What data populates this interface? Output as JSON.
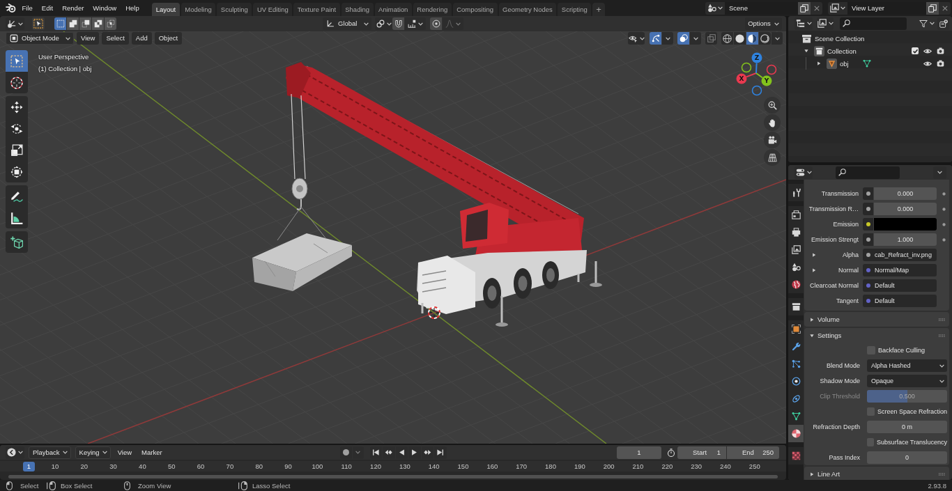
{
  "topbar": {
    "menus": [
      "File",
      "Edit",
      "Render",
      "Window",
      "Help"
    ],
    "workspaces": [
      {
        "label": "Layout",
        "selected": true
      },
      {
        "label": "Modeling",
        "selected": false
      },
      {
        "label": "Sculpting",
        "selected": false
      },
      {
        "label": "UV Editing",
        "selected": false
      },
      {
        "label": "Texture Paint",
        "selected": false
      },
      {
        "label": "Shading",
        "selected": false
      },
      {
        "label": "Animation",
        "selected": false
      },
      {
        "label": "Rendering",
        "selected": false
      },
      {
        "label": "Compositing",
        "selected": false
      },
      {
        "label": "Geometry Nodes",
        "selected": false
      },
      {
        "label": "Scripting",
        "selected": false
      }
    ],
    "add_workspace": "+",
    "scene": "Scene",
    "view_layer": "View Layer"
  },
  "viewport": {
    "tool_settings": {
      "select_modes": [
        {
          "kind": "set",
          "selected": true
        },
        {
          "kind": "extend",
          "selected": false
        },
        {
          "kind": "subtract",
          "selected": false
        },
        {
          "kind": "difference",
          "selected": false
        },
        {
          "kind": "intersect",
          "selected": false
        }
      ],
      "orientation": "Global",
      "options": "Options"
    },
    "header": {
      "mode": "Object Mode",
      "menus": [
        "View",
        "Select",
        "Add",
        "Object"
      ],
      "gizmos": true,
      "overlays": true,
      "xray": false,
      "shading": [
        {
          "kind": "wireframe",
          "selected": false
        },
        {
          "kind": "solid",
          "selected": false
        },
        {
          "kind": "material",
          "selected": true
        },
        {
          "kind": "rendered",
          "selected": false
        }
      ]
    },
    "info": [
      "User Perspective",
      "(1) Collection | obj"
    ],
    "toolbar": [
      {
        "tools": [
          {
            "kind": "select_box",
            "selected": true
          },
          {
            "kind": "cursor",
            "selected": false
          }
        ]
      },
      {
        "tools": [
          {
            "kind": "move",
            "selected": false
          },
          {
            "kind": "rotate",
            "selected": false
          },
          {
            "kind": "scale",
            "selected": false
          },
          {
            "kind": "transform",
            "selected": false
          }
        ]
      },
      {
        "tools": [
          {
            "kind": "annotate",
            "selected": false
          },
          {
            "kind": "measure",
            "selected": false
          }
        ]
      },
      {
        "tools": [
          {
            "kind": "add_cube",
            "selected": false
          }
        ]
      }
    ],
    "axes": [
      {
        "label": "X",
        "color": "#e8394f"
      },
      {
        "label": "Y",
        "color": "#83c21c"
      },
      {
        "label": "Z",
        "color": "#2f83e0"
      }
    ]
  },
  "timeline": {
    "menus": [
      {
        "label": "Playback",
        "kind": "dropdown"
      },
      {
        "label": "Keying",
        "kind": "dropdown"
      },
      {
        "label": "View",
        "kind": "menu"
      },
      {
        "label": "Marker",
        "kind": "menu"
      }
    ],
    "auto_keying": false,
    "current_frame": "1",
    "start": {
      "label": "Start",
      "value": "1"
    },
    "end": {
      "label": "End",
      "value": "250"
    },
    "ruler": [
      {
        "label": "1",
        "selected": true
      },
      {
        "label": "10",
        "selected": false
      },
      {
        "label": "20",
        "selected": false
      },
      {
        "label": "30",
        "selected": false
      },
      {
        "label": "40",
        "selected": false
      },
      {
        "label": "50",
        "selected": false
      },
      {
        "label": "60",
        "selected": false
      },
      {
        "label": "70",
        "selected": false
      },
      {
        "label": "80",
        "selected": false
      },
      {
        "label": "90",
        "selected": false
      },
      {
        "label": "100",
        "selected": false
      },
      {
        "label": "110",
        "selected": false
      },
      {
        "label": "120",
        "selected": false
      },
      {
        "label": "130",
        "selected": false
      },
      {
        "label": "140",
        "selected": false
      },
      {
        "label": "150",
        "selected": false
      },
      {
        "label": "160",
        "selected": false
      },
      {
        "label": "170",
        "selected": false
      },
      {
        "label": "180",
        "selected": false
      },
      {
        "label": "190",
        "selected": false
      },
      {
        "label": "200",
        "selected": false
      },
      {
        "label": "210",
        "selected": false
      },
      {
        "label": "220",
        "selected": false
      },
      {
        "label": "230",
        "selected": false
      },
      {
        "label": "240",
        "selected": false
      },
      {
        "label": "250",
        "selected": false
      }
    ]
  },
  "outliner": {
    "tree": [
      {
        "label": "Scene Collection",
        "kind": "scene_collection",
        "children": [
          {
            "label": "Collection",
            "kind": "collection",
            "expanded": true,
            "checked": true,
            "children": [
              {
                "label": "obj",
                "kind": "mesh_object",
                "expanded": false
              }
            ]
          }
        ]
      }
    ]
  },
  "properties": {
    "tab_groups": [
      {
        "tabs": [
          {
            "kind": "tool",
            "selected": false
          }
        ]
      },
      {
        "tabs": [
          {
            "kind": "render",
            "selected": false
          },
          {
            "kind": "output",
            "selected": false
          },
          {
            "kind": "view_layer",
            "selected": false
          },
          {
            "kind": "scene",
            "selected": false
          },
          {
            "kind": "world",
            "selected": false
          }
        ]
      },
      {
        "tabs": [
          {
            "kind": "collection",
            "selected": false
          }
        ]
      },
      {
        "tabs": [
          {
            "kind": "object",
            "selected": false
          },
          {
            "kind": "modifiers",
            "selected": false
          },
          {
            "kind": "particles",
            "selected": false
          },
          {
            "kind": "physics",
            "selected": false
          },
          {
            "kind": "constraints",
            "selected": false
          },
          {
            "kind": "data",
            "selected": false
          },
          {
            "kind": "material",
            "selected": true
          }
        ]
      },
      {
        "tabs": [
          {
            "kind": "texture",
            "selected": false
          }
        ]
      }
    ],
    "sockets": [
      {
        "label": "Transmission",
        "kind": "number",
        "color": "#a1a1a1",
        "value": "0.000"
      },
      {
        "label": "Transmission R…",
        "kind": "number",
        "color": "#a1a1a1",
        "value": "0.000"
      },
      {
        "label": "Emission",
        "kind": "color",
        "color": "#c7c729",
        "swatch": {
          "color": "#000000"
        }
      },
      {
        "label": "Emission Strengt",
        "kind": "number",
        "color": "#a1a1a1",
        "value": "1.000"
      },
      {
        "label": "Alpha",
        "kind": "link",
        "color": "#a1a1a1",
        "value": "cab_Refract_inv.png",
        "expanded": false
      },
      {
        "label": "Normal",
        "kind": "link",
        "color": "#6363c7",
        "value": "Normal/Map",
        "expanded": false
      },
      {
        "label": "Clearcoat Normal",
        "kind": "default",
        "color": "#6363c7",
        "value": "Default"
      },
      {
        "label": "Tangent",
        "kind": "default",
        "color": "#6363c7",
        "value": "Default"
      }
    ],
    "panels": [
      {
        "label": "Volume",
        "expanded": false
      },
      {
        "label": "Settings",
        "expanded": true,
        "items": [
          {
            "kind": "checkbox",
            "label": "Backface Culling",
            "checked": false
          },
          {
            "kind": "dropdown",
            "label": "Blend Mode",
            "value": "Alpha Hashed"
          },
          {
            "kind": "dropdown",
            "label": "Shadow Mode",
            "value": "Opaque"
          },
          {
            "kind": "slider",
            "label": "Clip Threshold",
            "value": "0.500",
            "level": 0.5,
            "disabled": true
          },
          {
            "kind": "checkbox",
            "label": "Screen Space Refraction",
            "checked": false
          },
          {
            "kind": "number",
            "label": "Refraction Depth",
            "value": "0 m"
          },
          {
            "kind": "checkbox",
            "label": "Subsurface Translucency",
            "checked": false
          },
          {
            "kind": "number",
            "label": "Pass Index",
            "value": "0"
          }
        ]
      },
      {
        "label": "Line Art",
        "expanded": false
      }
    ]
  },
  "status_bar": {
    "hints": [
      {
        "kind": "left_click",
        "label": "Select"
      },
      {
        "kind": "left_drag",
        "label": "Box Select"
      },
      {
        "kind": "middle",
        "label": "Zoom View"
      },
      {
        "kind": "right_drag",
        "label": "Lasso Select"
      }
    ],
    "version": "2.93.8"
  }
}
